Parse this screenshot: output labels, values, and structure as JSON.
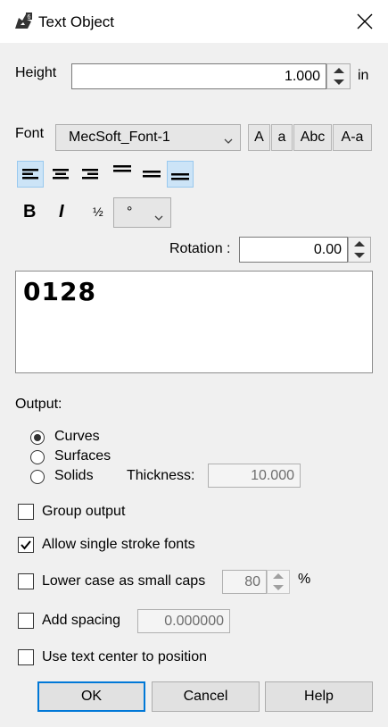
{
  "window": {
    "title": "Text Object",
    "app_icon": "rhino-app-icon",
    "close_icon": "close-icon"
  },
  "height": {
    "label": "Height",
    "value": "1.000",
    "unit": "in"
  },
  "font": {
    "label": "Font",
    "selected": "MecSoft_Font-1",
    "case_buttons": [
      "A",
      "a",
      "Abc",
      "A-a"
    ]
  },
  "alignment": {
    "buttons": [
      "align-left",
      "align-center",
      "align-right",
      "valign-top",
      "valign-middle",
      "valign-bottom"
    ],
    "active": [
      "align-left",
      "valign-bottom"
    ]
  },
  "style": {
    "bold": "B",
    "italic": "I",
    "fraction": "½",
    "symbol": "°"
  },
  "rotation": {
    "label": "Rotation :",
    "value": "0.00"
  },
  "text_preview": "0128",
  "output": {
    "label": "Output:",
    "options": [
      "Curves",
      "Surfaces",
      "Solids"
    ],
    "selected": "Curves",
    "thickness_label": "Thickness:",
    "thickness_value": "10.000"
  },
  "options": {
    "group_output": {
      "label": "Group output",
      "checked": false
    },
    "single_stroke": {
      "label": "Allow single stroke fonts",
      "checked": true
    },
    "small_caps": {
      "label": "Lower case as small caps",
      "checked": false,
      "value": "80",
      "unit": "%"
    },
    "add_spacing": {
      "label": "Add spacing",
      "checked": false,
      "value": "0.000000"
    },
    "text_center": {
      "label": "Use text center to position",
      "checked": false
    }
  },
  "buttons": {
    "ok": "OK",
    "cancel": "Cancel",
    "help": "Help"
  },
  "colors": {
    "accent": "#0078d7",
    "active_bg": "#cce4f7"
  }
}
